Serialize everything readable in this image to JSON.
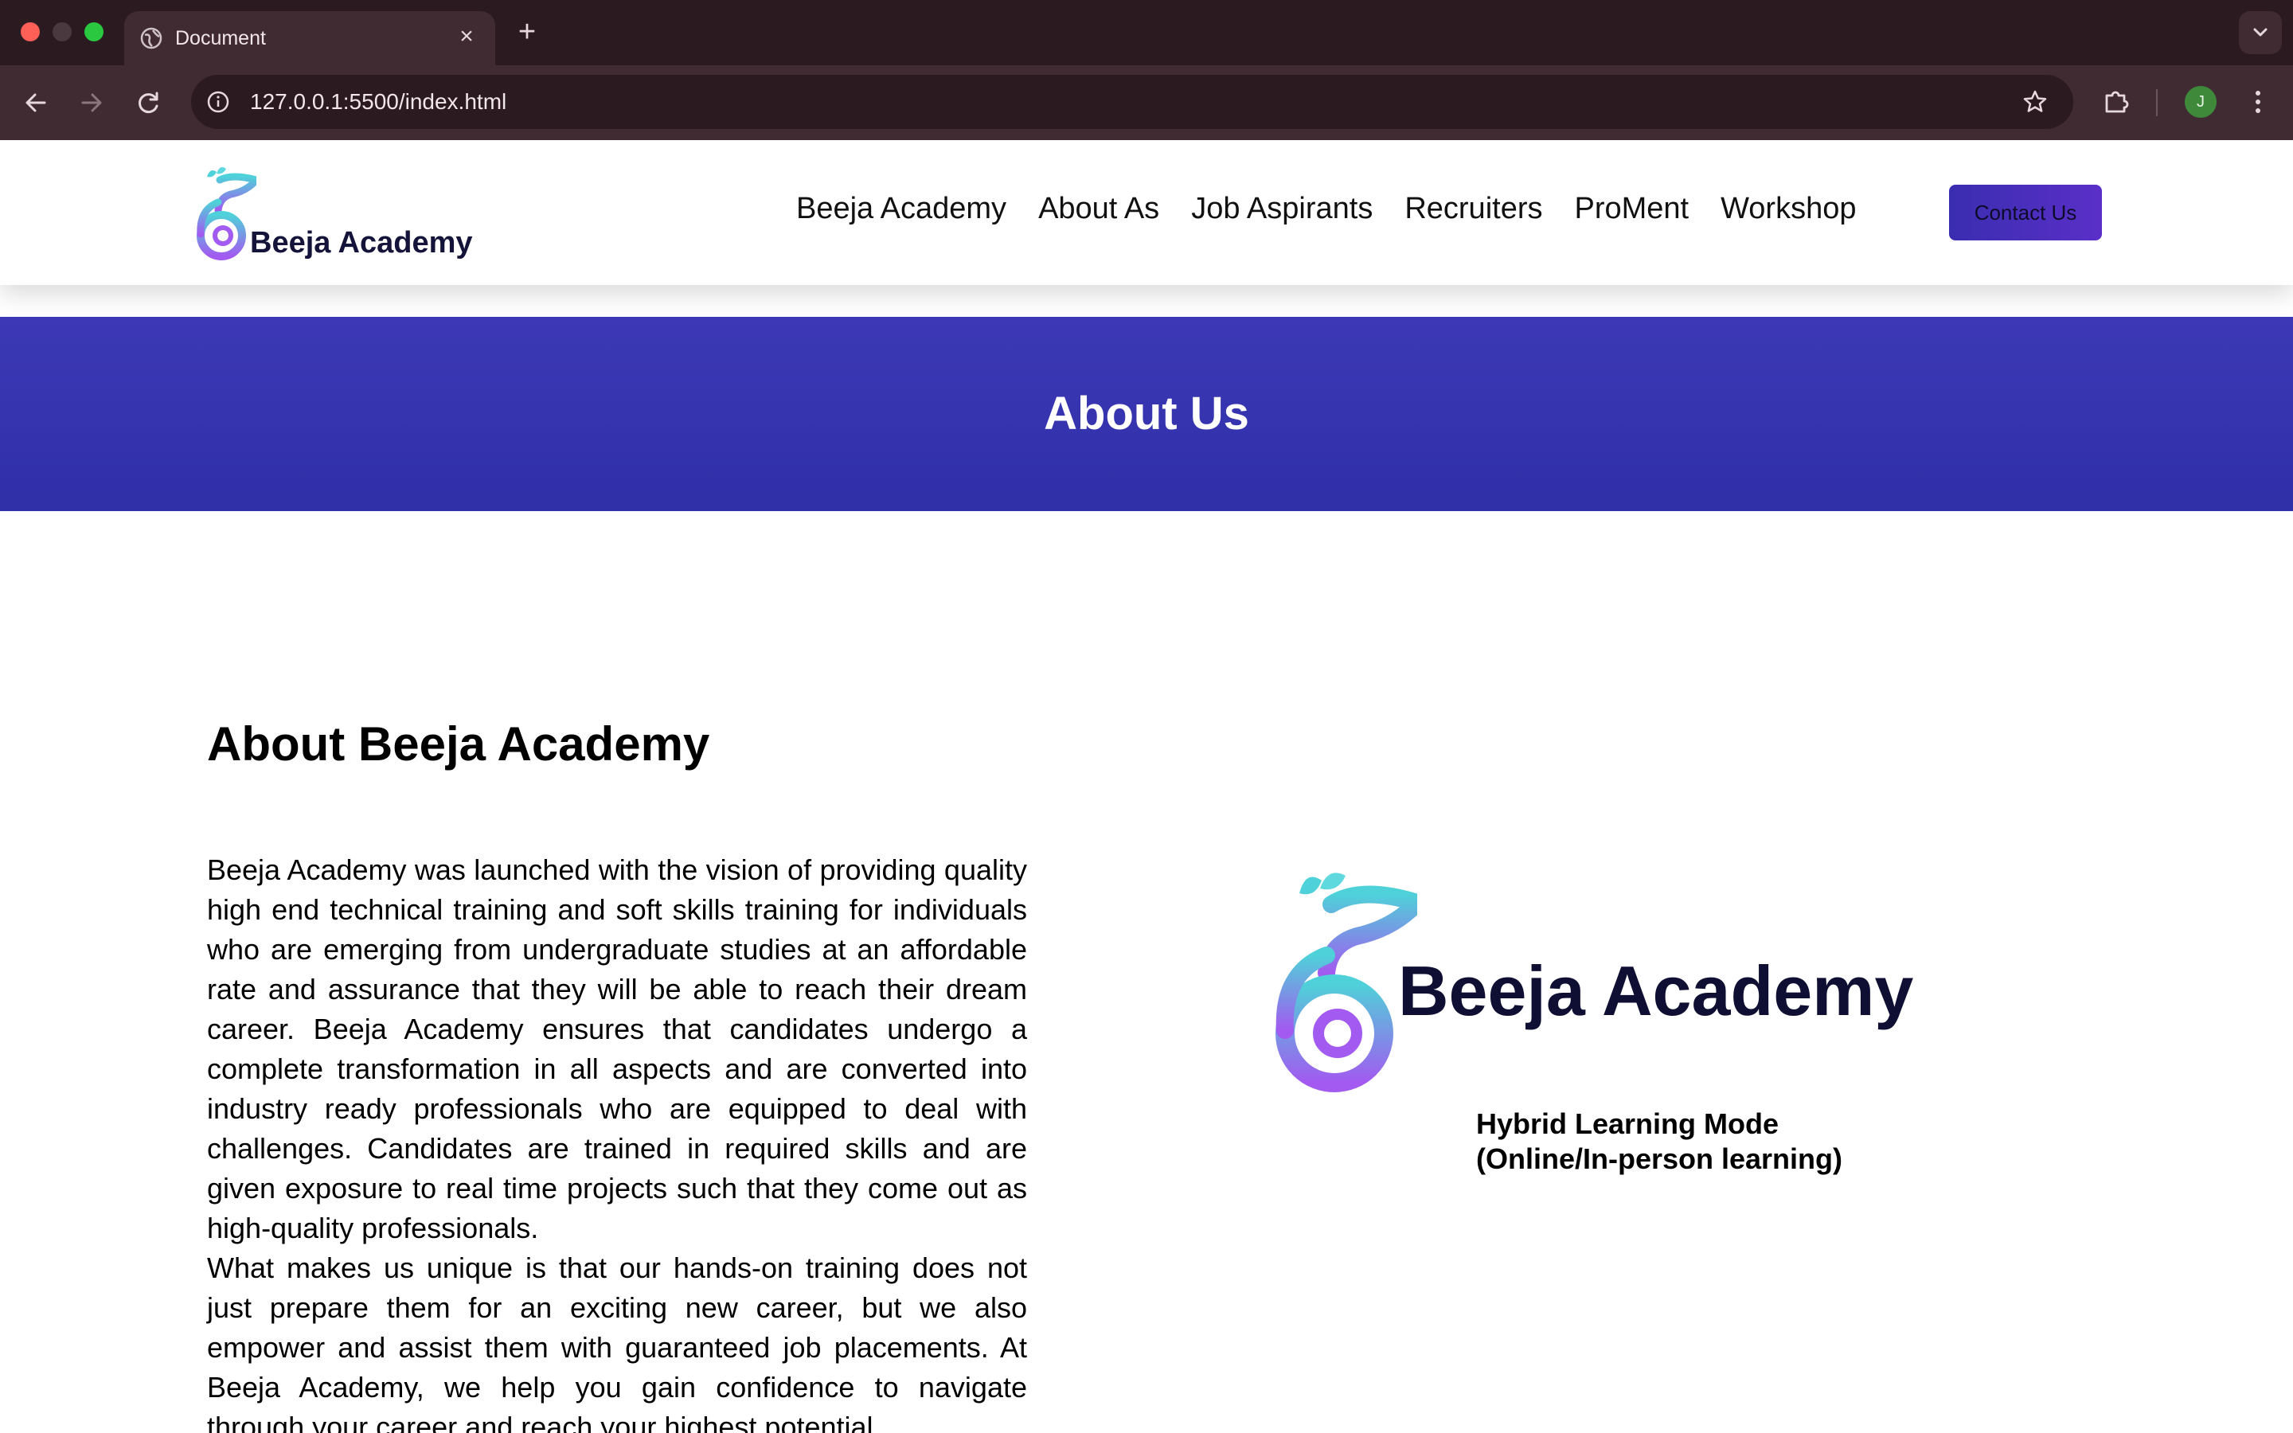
{
  "browser": {
    "tab_title": "Document",
    "tab_close": "×",
    "new_tab": "+",
    "url": "127.0.0.1:5500/index.html",
    "profile_initial": "J"
  },
  "site": {
    "brand_name": "Beeja Academy",
    "nav": [
      "Beeja Academy",
      "About As",
      "Job Aspirants",
      "Recruiters",
      "ProMent",
      "Workshop"
    ],
    "contact_label": "Contact Us"
  },
  "hero": {
    "title": "About Us"
  },
  "about": {
    "heading": "About Beeja Academy",
    "paragraph1": "Beeja Academy was launched with the vision of providing quality high end technical training and soft skills training for individuals who are emerging from undergraduate studies at an affordable rate and assurance that they will be able to reach their dream career. Beeja Academy ensures that candidates undergo a complete transformation in all aspects and are converted into industry ready professionals who are equipped to deal with challenges. Candidates are trained in required skills and are given exposure to real time projects such that they come out as high-quality professionals.",
    "paragraph2": "What makes us unique is that our hands-on training does not just prepare them for an exciting new career, but we also empower and assist them with guaranteed job placements. At Beeja Academy, we help you gain confidence to navigate through your career and reach your highest potential."
  },
  "logo_panel": {
    "brand_name": "Beeja Academy",
    "mode_line1": "Hybrid Learning Mode",
    "mode_line2": "(Online/In-person learning)"
  },
  "colors": {
    "hero_blue": "#3535b0",
    "contact_button": "#4a2fc0",
    "brand_text": "#14143a",
    "logo_teal": "#4fd1d9",
    "logo_purple": "#9b5cf0"
  }
}
